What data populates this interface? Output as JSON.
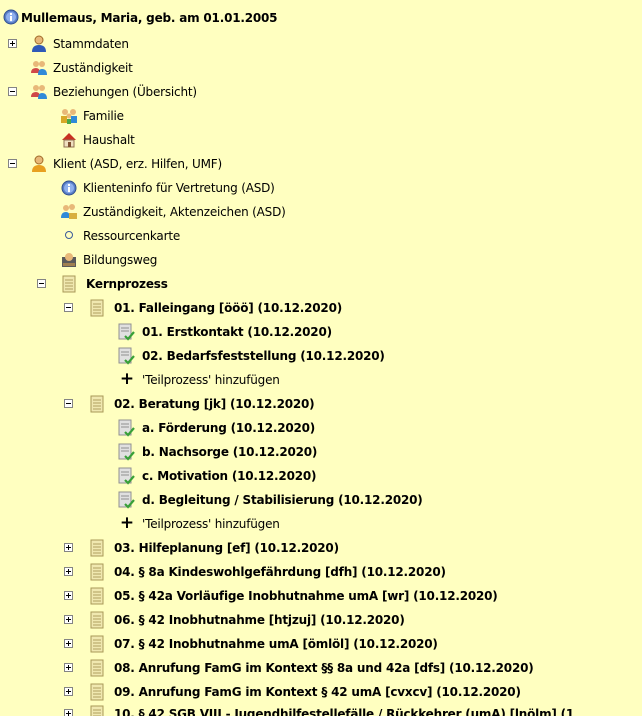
{
  "header": {
    "title": "Mullemaus, Maria, geb. am 01.01.2005",
    "icon": "info-icon"
  },
  "nodes": {
    "stammdaten": "Stammdaten",
    "zustaendigkeit": "Zuständigkeit",
    "beziehungen": "Beziehungen (Übersicht)",
    "familie": "Familie",
    "haushalt": "Haushalt",
    "klient": "Klient (ASD, erz. Hilfen, UMF)",
    "klienteninfo": "Klienteninfo für Vertretung (ASD)",
    "zust_akten": "Zuständigkeit, Aktenzeichen (ASD)",
    "ressourcenkarte": "Ressourcenkarte",
    "bildungsweg": "Bildungsweg",
    "kernprozess": "Kernprozess",
    "falleingang": "01. Falleingang [ööö] (10.12.2020)",
    "erstkontakt": "01. Erstkontakt (10.12.2020)",
    "bedarfsfeststellung": "02. Bedarfsfeststellung (10.12.2020)",
    "add_teilprozess_1": "'Teilprozess' hinzufügen",
    "beratung": "02. Beratung [jk] (10.12.2020)",
    "foerderung": "a. Förderung (10.12.2020)",
    "nachsorge": "b. Nachsorge (10.12.2020)",
    "motivation": "c. Motivation (10.12.2020)",
    "begleitung": "d. Begleitung / Stabilisierung (10.12.2020)",
    "add_teilprozess_2": "'Teilprozess' hinzufügen",
    "hilfeplanung": "03. Hilfeplanung [ef] (10.12.2020)",
    "kindeswohl": "04. § 8a Kindeswohlgefährdung [dfh] (10.12.2020)",
    "vorlaeufige": "05. § 42a Vorläufige Inobhutnahme umA [wr] (10.12.2020)",
    "inobhut": "06. § 42 Inobhutnahme [htjzuj] (10.12.2020)",
    "inobhut_uma": "07. § 42 Inobhutnahme umA [ömlöl] (10.12.2020)",
    "famg_8a": "08. Anrufung FamG im Kontext §§ 8a und 42a [dfs] (10.12.2020)",
    "famg_42": "09. Anrufung FamG im Kontext § 42 umA [cvxcv] (10.12.2020)",
    "sgb_viii": "10. § 42 SGB VIII - Jugendhilfestellefälle / Rückkehrer (umA) [lnölm] (1"
  }
}
